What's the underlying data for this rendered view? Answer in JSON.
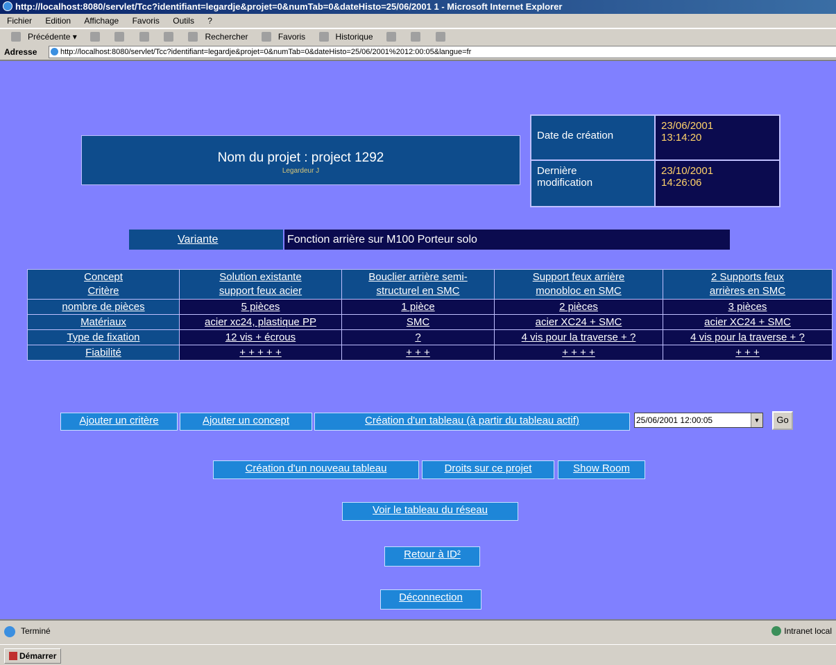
{
  "window": {
    "title": "http://localhost:8080/servlet/Tcc?identifiant=legardje&projet=0&numTab=0&dateHisto=25/06/2001 1 - Microsoft Internet Explorer"
  },
  "menu": [
    "Fichier",
    "Edition",
    "Affichage",
    "Favoris",
    "Outils",
    "?"
  ],
  "toolbar": {
    "back": "Précédente",
    "search": "Rechercher",
    "favorites": "Favoris",
    "history": "Historique"
  },
  "address": {
    "label": "Adresse",
    "url": "http://localhost:8080/servlet/Tcc?identifiant=legardje&projet=0&numTab=0&dateHisto=25/06/2001%2012:00:05&langue=fr"
  },
  "project": {
    "name": "Nom du projet : project 1292",
    "owner": "Legardeur J"
  },
  "dates": {
    "created_label": "Date de création",
    "created_value_date": "23/06/2001",
    "created_value_time": "13:14:20",
    "modified_label_1": "Dernière",
    "modified_label_2": "modification",
    "modified_value_date": "23/10/2001",
    "modified_value_time": "14:26:06"
  },
  "variant": {
    "label": "Variante",
    "value": "Fonction arrière sur M100 Porteur solo"
  },
  "table": {
    "corner_1": "Concept",
    "corner_2": "Critère",
    "concepts": [
      [
        "Solution existante",
        "support feux acier"
      ],
      [
        "Bouclier arrière semi-",
        "structurel en SMC"
      ],
      [
        "Support feux arrière",
        "monobloc en SMC"
      ],
      [
        "2 Supports feux",
        "arrières en SMC"
      ]
    ],
    "rows": [
      {
        "criterion": "nombre de pièces",
        "values": [
          "5 pièces",
          "1 pièce",
          "2 pièces",
          "3 pièces"
        ]
      },
      {
        "criterion": "Matériaux",
        "values": [
          "acier xc24, plastique PP",
          "SMC",
          "acier XC24 + SMC",
          "acier XC24 + SMC"
        ]
      },
      {
        "criterion": "Type de fixation",
        "values": [
          "12 vis + écrous",
          "?",
          "4 vis pour la traverse + ?",
          "4 vis pour la traverse + ?"
        ]
      },
      {
        "criterion": "Fiabilité",
        "values": [
          "+ + + + +",
          "+ + +",
          "+ + + +",
          "+ + +"
        ]
      }
    ]
  },
  "actions": {
    "add_criterion": "Ajouter un critère",
    "add_concept": "Ajouter un concept",
    "create_from_active": "Création d'un tableau (à partir du tableau actif)",
    "date_select": "25/06/2001 12:00:05",
    "go": "Go",
    "create_new": "Création d'un nouveau tableau",
    "rights": "Droits sur ce projet",
    "show_room": "Show Room",
    "network_table": "Voir le tableau du réseau",
    "back_id": "Retour à ID²",
    "logout": "Déconnection"
  },
  "status": {
    "left": "Terminé",
    "right": "Intranet local"
  },
  "taskbar": {
    "start": "Démarrer"
  },
  "colors": {
    "page_bg": "#8080ff",
    "navy": "#0b0b4f",
    "blue": "#0e4c8c",
    "button": "#1e86d8",
    "date_value": "#ffd36a"
  }
}
